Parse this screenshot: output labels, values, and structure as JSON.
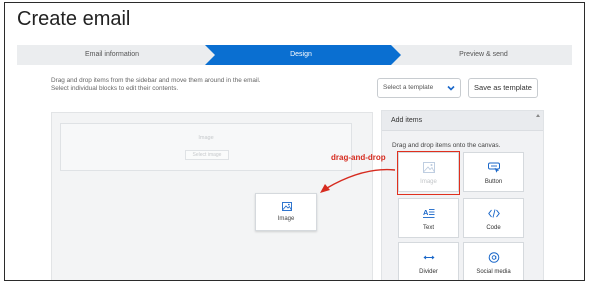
{
  "page": {
    "title": "Create email"
  },
  "stepper": {
    "steps": [
      {
        "label": "Email information",
        "state": "done"
      },
      {
        "label": "Design",
        "state": "active"
      },
      {
        "label": "Preview & send",
        "state": "upcoming"
      }
    ],
    "active_color": "#0a6fd1"
  },
  "toolbar": {
    "instructions_line1": "Drag and drop items from the sidebar and move them around in the email.",
    "instructions_line2": "Select individual blocks to edit their contents.",
    "select_template_placeholder": "Select a template",
    "save_as_template_label": "Save as template"
  },
  "canvas": {
    "ghost_block_label": "Image",
    "ghost_button_label": "Select image",
    "dragged_item_label": "Image"
  },
  "sidebar": {
    "header": "Add items",
    "hint": "Drag and drop items onto the canvas.",
    "items": [
      {
        "label": "Image",
        "icon": "image-icon"
      },
      {
        "label": "Button",
        "icon": "button-icon"
      },
      {
        "label": "Text",
        "icon": "text-icon"
      },
      {
        "label": "Code",
        "icon": "code-icon"
      },
      {
        "label": "Divider",
        "icon": "divider-icon"
      },
      {
        "label": "Social media",
        "icon": "social-media-icon"
      }
    ]
  },
  "annotation": {
    "text": "drag-and-drop",
    "color": "#d62b1f"
  },
  "colors": {
    "accent": "#0a6fd1",
    "icon_blue": "#1a67c9",
    "highlight": "#e0301e"
  }
}
